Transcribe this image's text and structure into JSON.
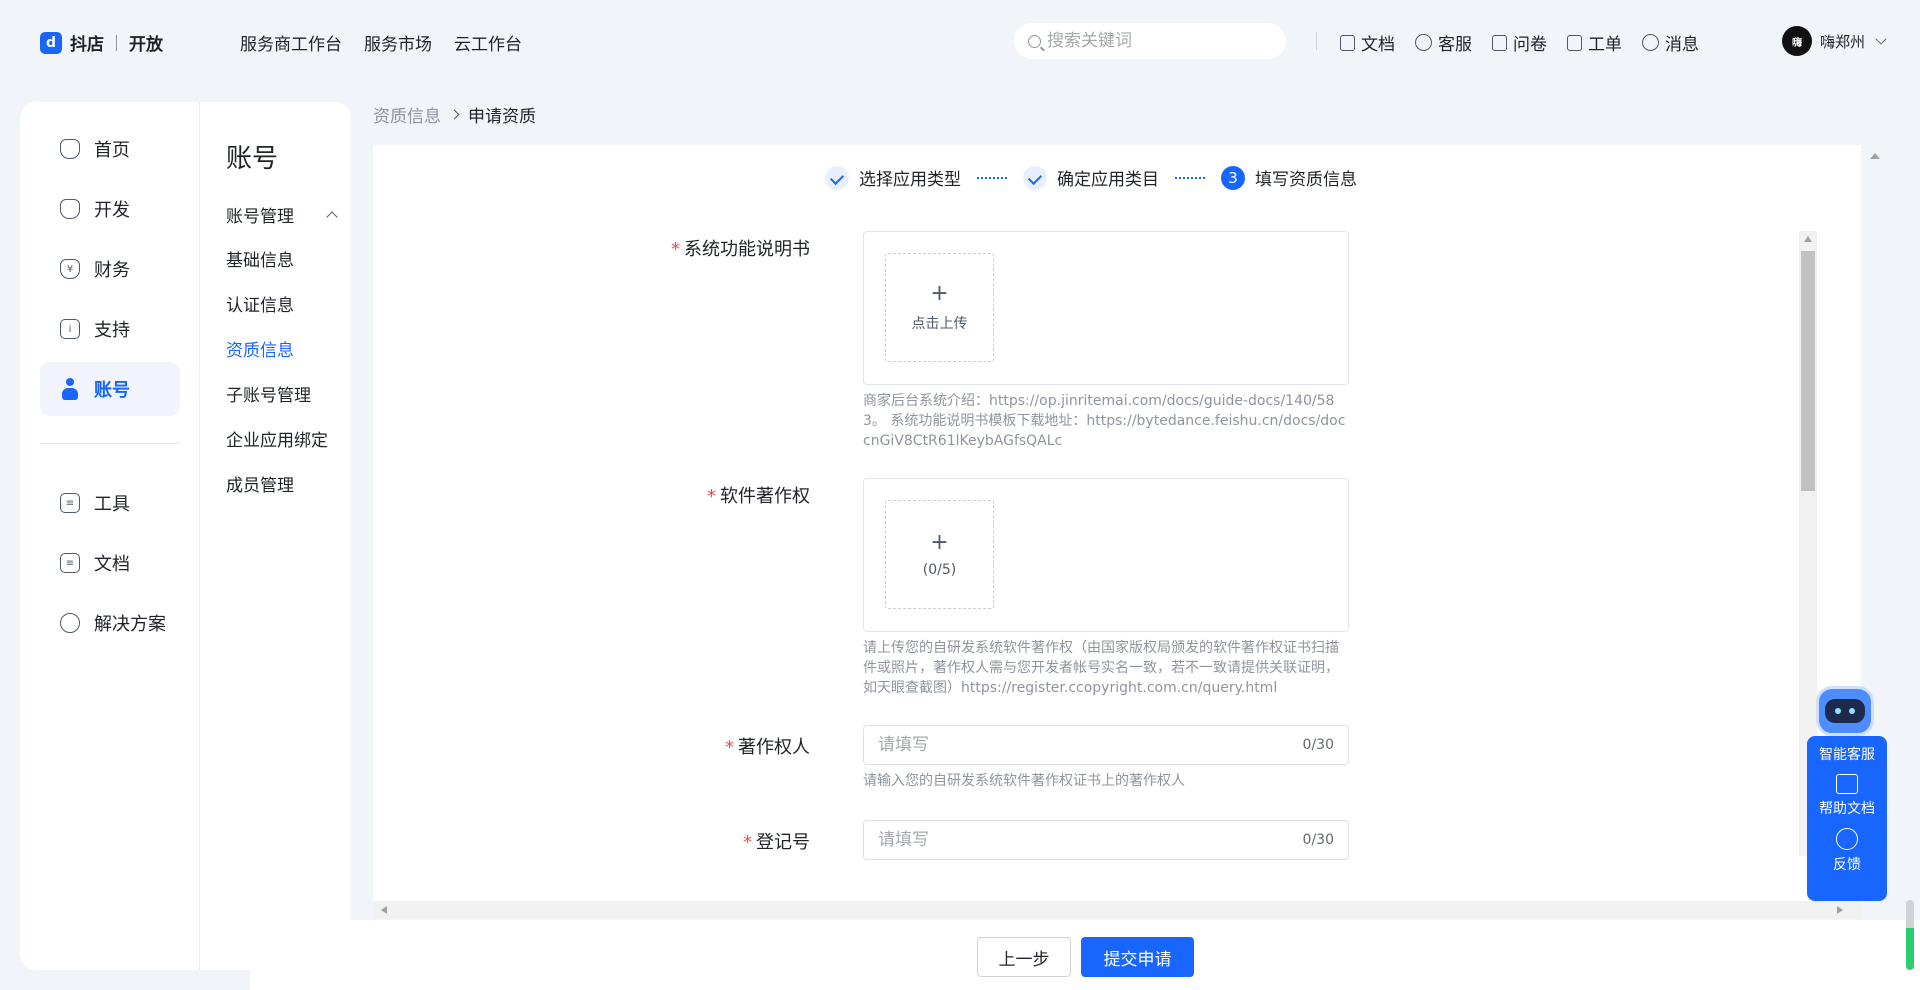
{
  "header": {
    "logo_text": "抖店",
    "logo_sub": "开放",
    "nav": [
      "服务商工作台",
      "服务市场",
      "云工作台"
    ],
    "search_placeholder": "搜索关键词",
    "tools": [
      {
        "label": "文档",
        "icon": "document-icon"
      },
      {
        "label": "客服",
        "icon": "smile-icon"
      },
      {
        "label": "问卷",
        "icon": "megaphone-icon"
      },
      {
        "label": "工单",
        "icon": "ticket-icon"
      },
      {
        "label": "消息",
        "icon": "bell-icon"
      }
    ],
    "user_name": "嗨郑州",
    "avatar_text": "嗨"
  },
  "sidebar": {
    "items": [
      {
        "label": "首页",
        "icon": "home-icon"
      },
      {
        "label": "开发",
        "icon": "cube-icon"
      },
      {
        "label": "财务",
        "icon": "finance-shield-icon"
      },
      {
        "label": "支持",
        "icon": "info-icon"
      },
      {
        "label": "账号",
        "icon": "user-icon",
        "active": true
      },
      {
        "label": "工具",
        "icon": "toolbox-icon"
      },
      {
        "label": "文档",
        "icon": "document-icon"
      },
      {
        "label": "解决方案",
        "icon": "lightbulb-icon"
      }
    ]
  },
  "subnav": {
    "title": "账号",
    "group": "账号管理",
    "items": [
      "基础信息",
      "认证信息",
      "资质信息",
      "子账号管理",
      "企业应用绑定",
      "成员管理"
    ],
    "active": "资质信息"
  },
  "breadcrumb": {
    "prev": "资质信息",
    "current": "申请资质"
  },
  "steps": [
    {
      "label": "选择应用类型",
      "status": "done"
    },
    {
      "label": "确定应用类目",
      "status": "done"
    },
    {
      "label": "填写资质信息",
      "status": "current",
      "number": "3"
    }
  ],
  "form": {
    "manual": {
      "label": "系统功能说明书",
      "upload_text": "点击上传",
      "hint": "商家后台系统介绍：https://op.jinritemai.com/docs/guide-docs/140/583。 系统功能说明书模板下载地址：https://bytedance.feishu.cn/docs/doccnGiV8CtR61lKeybAGfsQALc"
    },
    "copyright": {
      "label": "软件著作权",
      "upload_text": "(0/5)",
      "hint": "请上传您的自研发系统软件著作权（由国家版权局颁发的软件著作权证书扫描件或照片，著作权人需与您开发者帐号实名一致，若不一致请提供关联证明，如天眼查截图）https://register.ccopyright.com.cn/query.html"
    },
    "owner": {
      "label": "著作权人",
      "placeholder": "请填写",
      "value": "",
      "counter": "0/30",
      "hint": "请输入您的自研发系统软件著作权证书上的著作权人"
    },
    "regno": {
      "label": "登记号",
      "placeholder": "请填写",
      "value": "",
      "counter": "0/30"
    }
  },
  "footer": {
    "prev_label": "上一步",
    "submit_label": "提交申请"
  },
  "help_widget": {
    "items": [
      "智能客服",
      "帮助文档",
      "反馈"
    ]
  },
  "colors": {
    "accent": "#1966ff",
    "required": "#f54a45",
    "hint": "#8f959e"
  }
}
